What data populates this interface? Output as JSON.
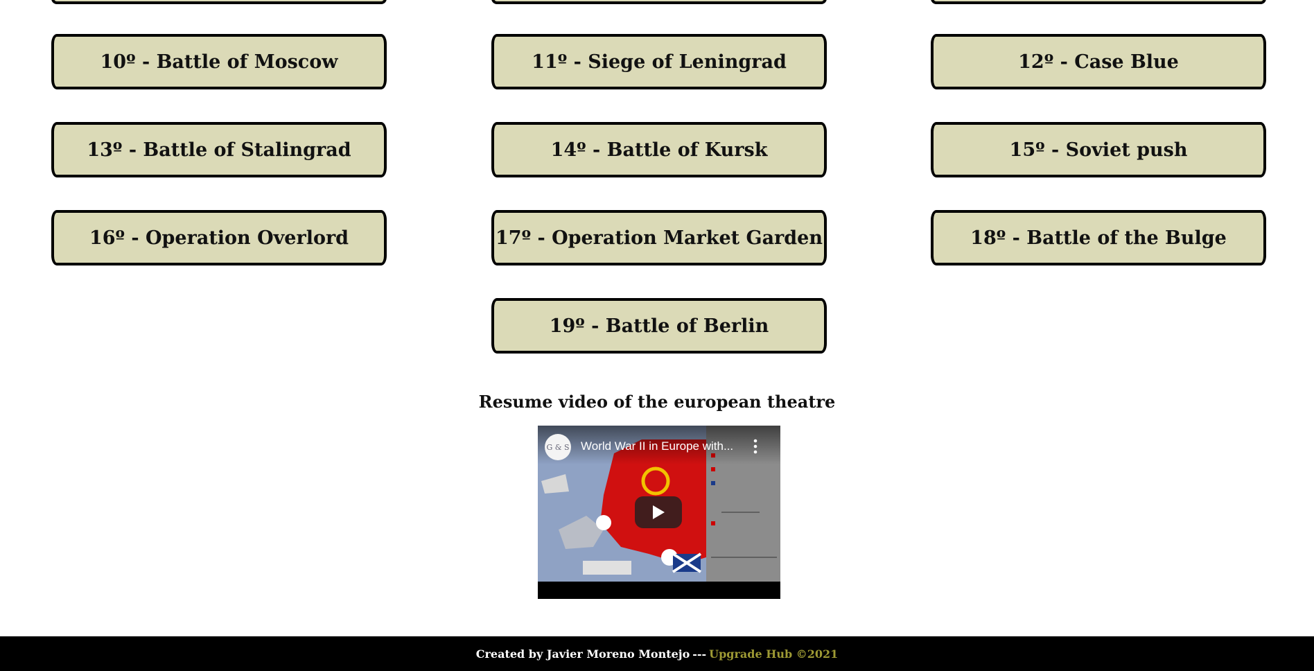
{
  "battles": [
    {
      "label": "10º - Battle of Moscow"
    },
    {
      "label": "11º - Siege of Leningrad"
    },
    {
      "label": "12º - Case Blue"
    },
    {
      "label": "13º - Battle of Stalingrad"
    },
    {
      "label": "14º - Battle of Kursk"
    },
    {
      "label": "15º - Soviet push"
    },
    {
      "label": "16º - Operation Overlord"
    },
    {
      "label": "17º - Operation Market Garden"
    },
    {
      "label": "18º - Battle of the Bulge"
    },
    {
      "label": "19º - Battle of Berlin"
    }
  ],
  "video_section": {
    "heading": "Resume video of the european theatre",
    "video_title": "World War II in Europe with...",
    "channel_initials": "G & S"
  },
  "footer": {
    "credit": "Created by Javier Moreno Montejo",
    "separator": "---",
    "brand": "Upgrade Hub ©2021"
  },
  "colors": {
    "button_bg": "#dbdab7",
    "footer_bg": "#000000",
    "footer_brand": "#9e9a34"
  }
}
